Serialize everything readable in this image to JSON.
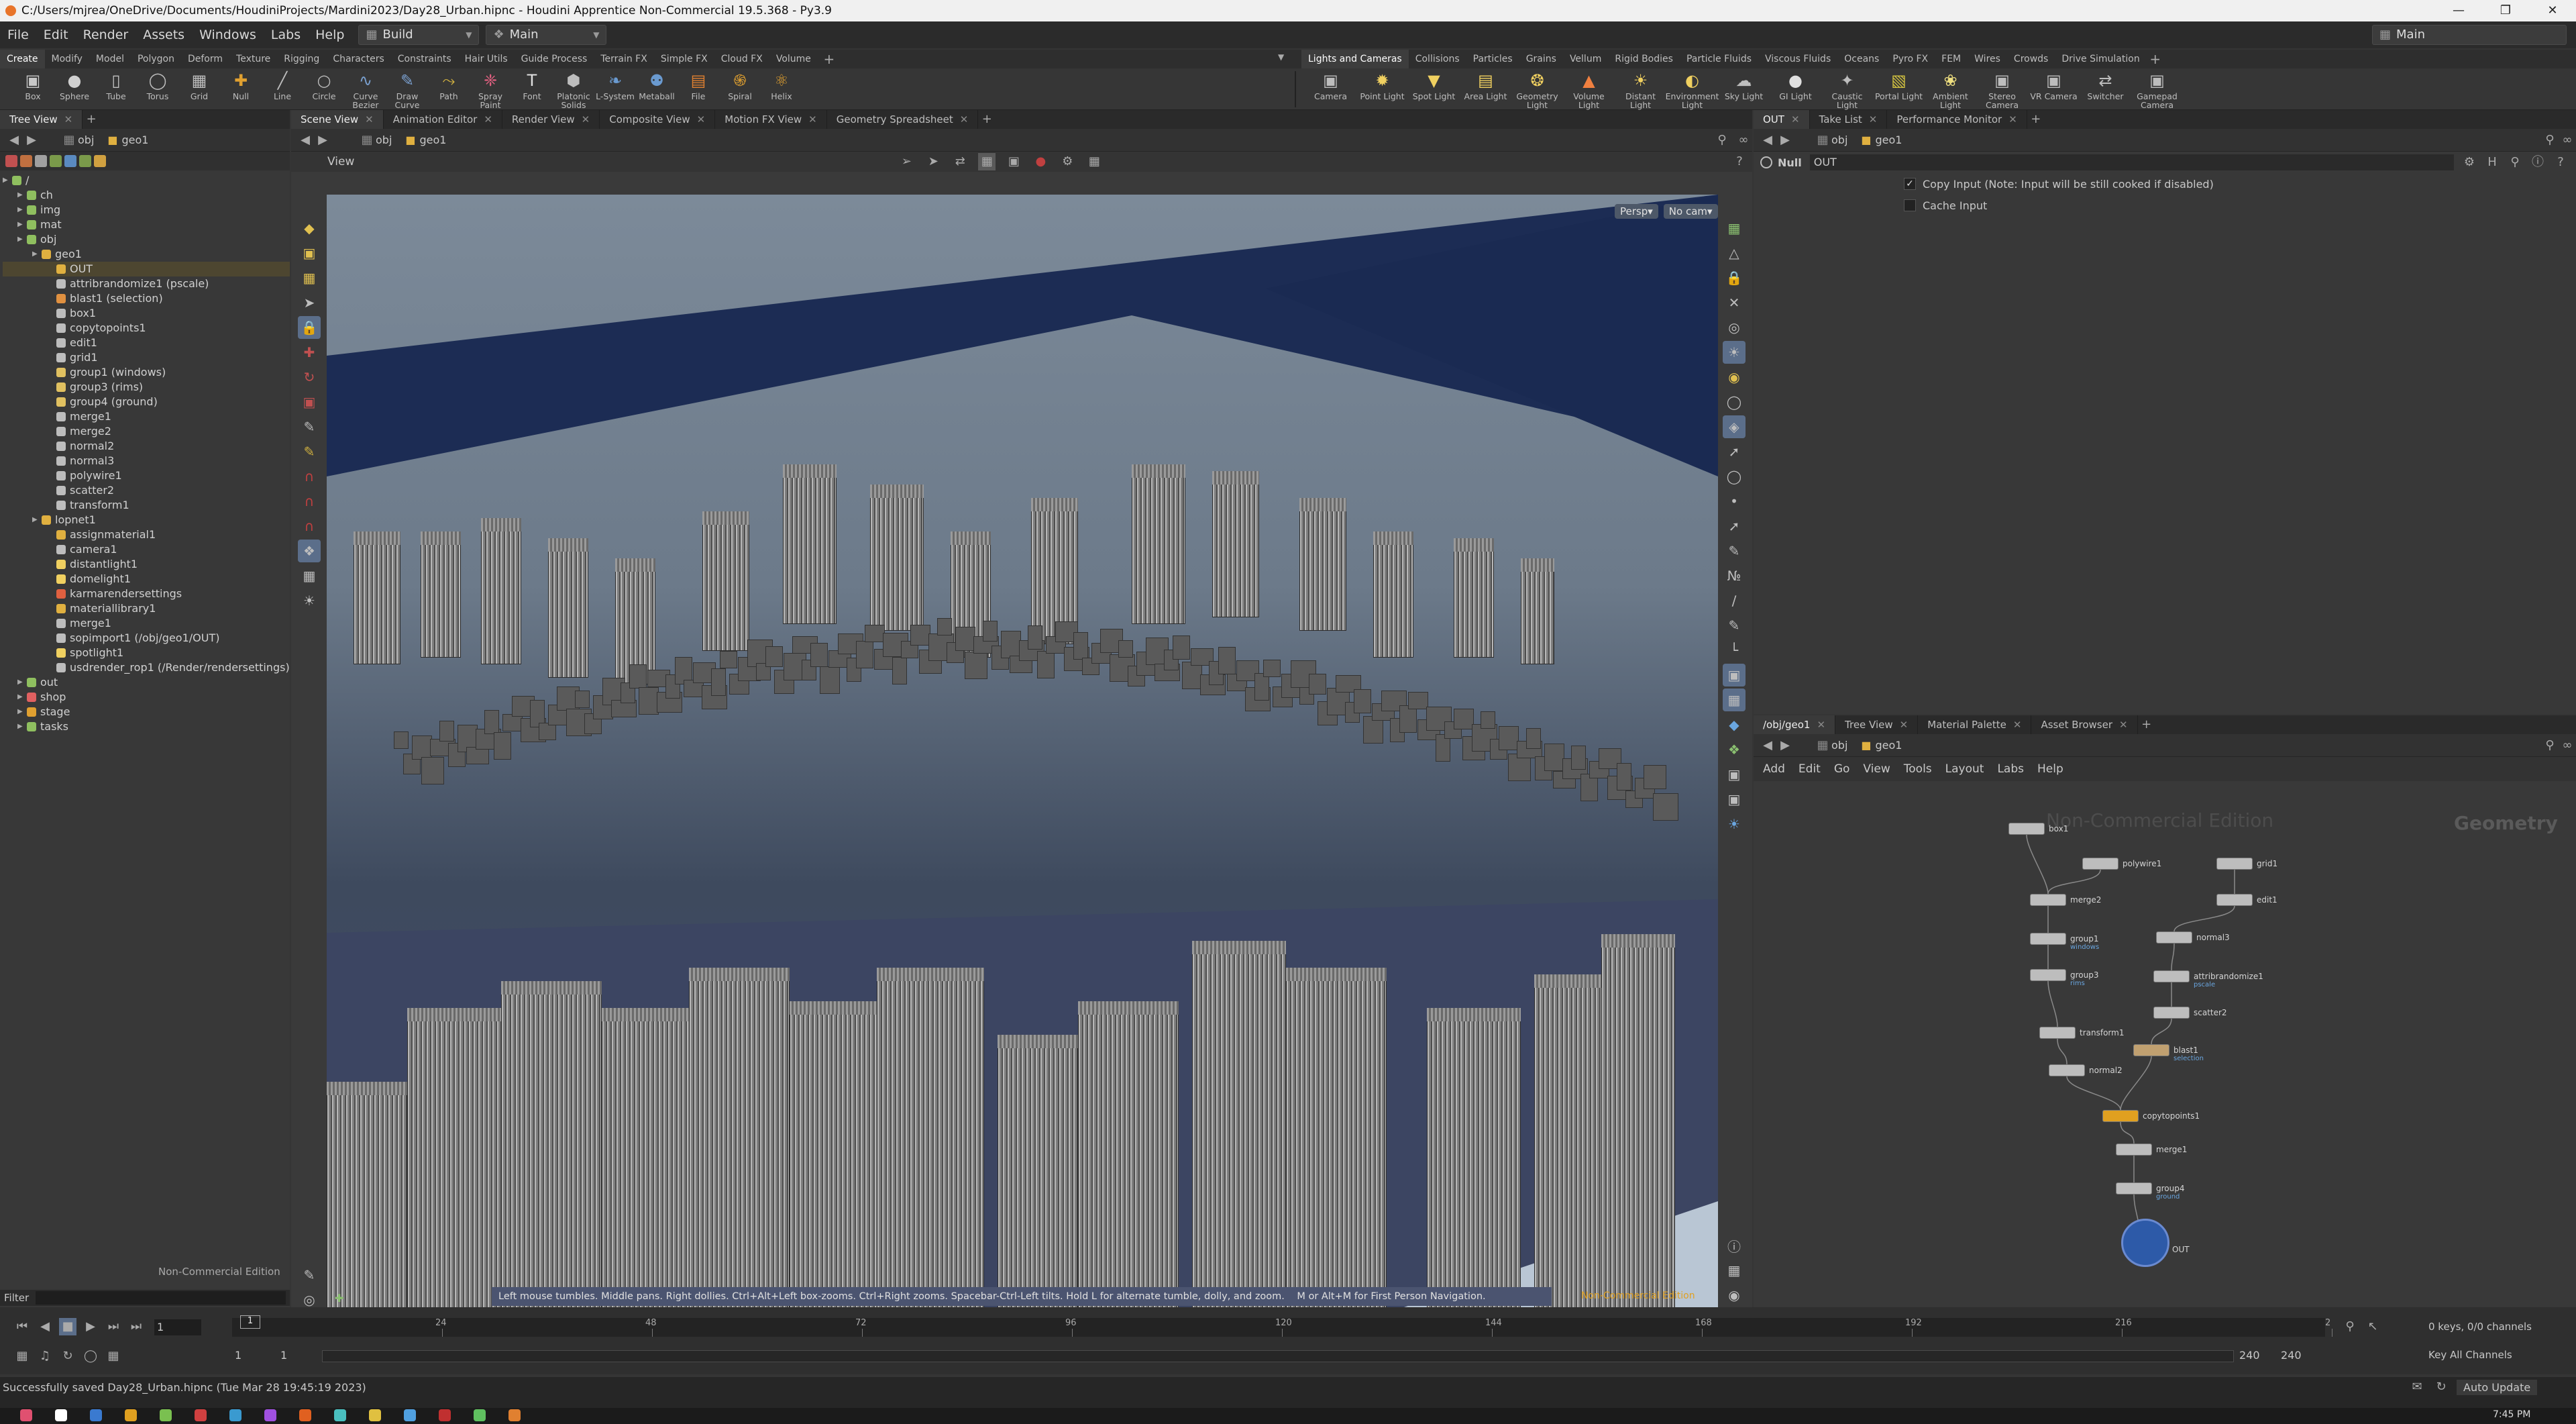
{
  "title_bar": {
    "title": "C:/Users/mjrea/OneDrive/Documents/HoudiniProjects/Mardini2023/Day28_Urban.hipnc - Houdini Apprentice Non-Commercial 19.5.368 - Py3.9"
  },
  "menu": {
    "items": [
      "File",
      "Edit",
      "Render",
      "Assets",
      "Windows",
      "Labs",
      "Help"
    ],
    "desktop_value": "Build",
    "main_value": "Main",
    "right_desktop_value": "Main"
  },
  "shelf_tabs_left": [
    "Create",
    "Modify",
    "Model",
    "Polygon",
    "Deform",
    "Texture",
    "Rigging",
    "Characters",
    "Constraints",
    "Hair Utils",
    "Guide Process",
    "Terrain FX",
    "Simple FX",
    "Cloud FX",
    "Volume"
  ],
  "shelf_tabs_right": [
    "Lights and Cameras",
    "Collisions",
    "Particles",
    "Grains",
    "Vellum",
    "Rigid Bodies",
    "Particle Fluids",
    "Viscous Fluids",
    "Oceans",
    "Pyro FX",
    "FEM",
    "Wires",
    "Crowds",
    "Drive Simulation"
  ],
  "shelf_tools_left": [
    {
      "label": "Box",
      "icon": "cube-icon",
      "color": "#c8c8c8"
    },
    {
      "label": "Sphere",
      "icon": "sphere-icon",
      "color": "#d0d0d0"
    },
    {
      "label": "Tube",
      "icon": "tube-icon",
      "color": "#c0c0c0"
    },
    {
      "label": "Torus",
      "icon": "torus-icon",
      "color": "#bdbdbd"
    },
    {
      "label": "Grid",
      "icon": "grid-icon",
      "color": "#bdbdbd"
    },
    {
      "label": "Null",
      "icon": "null-icon",
      "color": "#e0a030"
    },
    {
      "label": "Line",
      "icon": "line-icon",
      "color": "#bdbdbd"
    },
    {
      "label": "Circle",
      "icon": "circle-icon",
      "color": "#bdbdbd"
    },
    {
      "label": "Curve Bezier",
      "icon": "curve-icon",
      "color": "#7aa0d0"
    },
    {
      "label": "Draw Curve",
      "icon": "pen-icon",
      "color": "#7aa0d0"
    },
    {
      "label": "Path",
      "icon": "path-icon",
      "color": "#d0b040"
    },
    {
      "label": "Spray Paint",
      "icon": "spray-icon",
      "color": "#e06080"
    },
    {
      "label": "Font",
      "icon": "font-icon",
      "color": "#e0e0e0"
    },
    {
      "label": "Platonic Solids",
      "icon": "platonic-icon",
      "color": "#bdbdbd"
    },
    {
      "label": "L-System",
      "icon": "lsystem-icon",
      "color": "#6a9ad0"
    },
    {
      "label": "Metaball",
      "icon": "metaball-icon",
      "color": "#6a9ad0"
    },
    {
      "label": "File",
      "icon": "file-icon",
      "color": "#e08030"
    },
    {
      "label": "Spiral",
      "icon": "spiral-icon",
      "color": "#e0a030"
    },
    {
      "label": "Helix",
      "icon": "helix-icon",
      "color": "#e0a030"
    }
  ],
  "shelf_tools_right": [
    {
      "label": "Camera",
      "icon": "camera-icon",
      "color": "#bdbdbd"
    },
    {
      "label": "Point Light",
      "icon": "point-light-icon",
      "color": "#f0d060"
    },
    {
      "label": "Spot Light",
      "icon": "spot-light-icon",
      "color": "#f0d060"
    },
    {
      "label": "Area Light",
      "icon": "area-light-icon",
      "color": "#f0d060"
    },
    {
      "label": "Geometry Light",
      "icon": "geometry-light-icon",
      "color": "#f0d060"
    },
    {
      "label": "Volume Light",
      "icon": "volume-light-icon",
      "color": "#f08040"
    },
    {
      "label": "Distant Light",
      "icon": "distant-light-icon",
      "color": "#f0d060"
    },
    {
      "label": "Environment Light",
      "icon": "environment-light-icon",
      "color": "#f0d060"
    },
    {
      "label": "Sky Light",
      "icon": "sky-light-icon",
      "color": "#bdbdbd"
    },
    {
      "label": "GI Light",
      "icon": "gi-light-icon",
      "color": "#e0e0e0"
    },
    {
      "label": "Caustic Light",
      "icon": "caustic-light-icon",
      "color": "#bdbdbd"
    },
    {
      "label": "Portal Light",
      "icon": "portal-light-icon",
      "color": "#d0c040"
    },
    {
      "label": "Ambient Light",
      "icon": "ambient-light-icon",
      "color": "#f0e080"
    },
    {
      "label": "Stereo Camera",
      "icon": "stereo-camera-icon",
      "color": "#bdbdbd"
    },
    {
      "label": "VR Camera",
      "icon": "vr-camera-icon",
      "color": "#bdbdbd"
    },
    {
      "label": "Switcher",
      "icon": "switcher-icon",
      "color": "#bdbdbd"
    },
    {
      "label": "Gamepad Camera",
      "icon": "gamepad-camera-icon",
      "color": "#bdbdbd"
    }
  ],
  "tree_pane": {
    "tab": "Tree View",
    "path_obj": "obj",
    "path_node": "geo1",
    "nodes": [
      {
        "label": "/",
        "indent": 0,
        "color": "#8fbf5f"
      },
      {
        "label": "ch",
        "indent": 1,
        "color": "#8fbf5f"
      },
      {
        "label": "img",
        "indent": 1,
        "color": "#8fbf5f"
      },
      {
        "label": "mat",
        "indent": 1,
        "color": "#8fbf5f"
      },
      {
        "label": "obj",
        "indent": 1,
        "color": "#8fbf5f"
      },
      {
        "label": "geo1",
        "indent": 2,
        "color": "#e0b040"
      },
      {
        "label": "OUT",
        "indent": 3,
        "color": "#e0b040",
        "selected": true
      },
      {
        "label": "attribrandomize1 (pscale)",
        "indent": 3,
        "color": "#bdbdbd"
      },
      {
        "label": "blast1 (selection)",
        "indent": 3,
        "color": "#e09040"
      },
      {
        "label": "box1",
        "indent": 3,
        "color": "#bdbdbd"
      },
      {
        "label": "copytopoints1",
        "indent": 3,
        "color": "#bdbdbd"
      },
      {
        "label": "edit1",
        "indent": 3,
        "color": "#bdbdbd"
      },
      {
        "label": "grid1",
        "indent": 3,
        "color": "#bdbdbd"
      },
      {
        "label": "group1 (windows)",
        "indent": 3,
        "color": "#e0c060"
      },
      {
        "label": "group3 (rims)",
        "indent": 3,
        "color": "#e0c060"
      },
      {
        "label": "group4 (ground)",
        "indent": 3,
        "color": "#e0c060"
      },
      {
        "label": "merge1",
        "indent": 3,
        "color": "#bdbdbd"
      },
      {
        "label": "merge2",
        "indent": 3,
        "color": "#bdbdbd"
      },
      {
        "label": "normal2",
        "indent": 3,
        "color": "#bdbdbd"
      },
      {
        "label": "normal3",
        "indent": 3,
        "color": "#bdbdbd"
      },
      {
        "label": "polywire1",
        "indent": 3,
        "color": "#bdbdbd"
      },
      {
        "label": "scatter2",
        "indent": 3,
        "color": "#bdbdbd"
      },
      {
        "label": "transform1",
        "indent": 3,
        "color": "#bdbdbd"
      },
      {
        "label": "lopnet1",
        "indent": 2,
        "color": "#e0b040"
      },
      {
        "label": "assignmaterial1",
        "indent": 3,
        "color": "#e0b040"
      },
      {
        "label": "camera1",
        "indent": 3,
        "color": "#bdbdbd"
      },
      {
        "label": "distantlight1",
        "indent": 3,
        "color": "#f0d060"
      },
      {
        "label": "domelight1",
        "indent": 3,
        "color": "#f0d060"
      },
      {
        "label": "karmarendersettings",
        "indent": 3,
        "color": "#e06040"
      },
      {
        "label": "materiallibrary1",
        "indent": 3,
        "color": "#e0b040"
      },
      {
        "label": "merge1",
        "indent": 3,
        "color": "#bdbdbd"
      },
      {
        "label": "sopimport1 (/obj/geo1/OUT)",
        "indent": 3,
        "color": "#bdbdbd"
      },
      {
        "label": "spotlight1",
        "indent": 3,
        "color": "#f0d060"
      },
      {
        "label": "usdrender_rop1 (/Render/rendersettings)",
        "indent": 3,
        "color": "#bdbdbd"
      },
      {
        "label": "out",
        "indent": 1,
        "color": "#8fbf5f"
      },
      {
        "label": "shop",
        "indent": 1,
        "color": "#e06060"
      },
      {
        "label": "stage",
        "indent": 1,
        "color": "#e0a030"
      },
      {
        "label": "tasks",
        "indent": 1,
        "color": "#8fbf5f"
      }
    ],
    "watermark": "Non-Commercial Edition",
    "filter_label": "Filter"
  },
  "viewer": {
    "tabs": [
      "Scene View",
      "Animation Editor",
      "Render View",
      "Composite View",
      "Motion FX View",
      "Geometry Spreadsheet"
    ],
    "path_obj": "obj",
    "path_node": "geo1",
    "view_label": "View",
    "persp_label": "Persp▾",
    "cam_label": "No cam▾",
    "hint": "Left mouse tumbles. Middle pans. Right dollies. Ctrl+Alt+Left box-zooms. Ctrl+Right zooms. Spacebar-Ctrl-Left tilts. Hold L for alternate tumble, dolly, and zoom.    M or Alt+M for First Person Navigation.",
    "watermark": "Non-Commercial Edition"
  },
  "params": {
    "tabs": [
      "OUT",
      "Take List",
      "Performance Monitor"
    ],
    "path_obj": "obj",
    "path_node": "geo1",
    "node_type": "Null",
    "node_name": "OUT",
    "opt1": "Copy Input (Note: Input will be still cooked if disabled)",
    "opt2": "Cache Input"
  },
  "network": {
    "tabs": [
      "/obj/geo1",
      "Tree View",
      "Material Palette",
      "Asset Browser"
    ],
    "path_obj": "obj",
    "path_node": "geo1",
    "menu": [
      "Add",
      "Edit",
      "Go",
      "View",
      "Tools",
      "Layout",
      "Labs",
      "Help"
    ],
    "watermark": "Non-Commercial Edition",
    "context_label": "Geometry",
    "nodes": [
      {
        "name": "box1",
        "flag": ""
      },
      {
        "name": "polywire1",
        "flag": ""
      },
      {
        "name": "grid1",
        "flag": ""
      },
      {
        "name": "merge2",
        "flag": ""
      },
      {
        "name": "edit1",
        "flag": ""
      },
      {
        "name": "group1",
        "flag": "windows"
      },
      {
        "name": "normal3",
        "flag": ""
      },
      {
        "name": "group3",
        "flag": "rims"
      },
      {
        "name": "attribrandomize1",
        "flag": "pscale"
      },
      {
        "name": "scatter2",
        "flag": ""
      },
      {
        "name": "transform1",
        "flag": ""
      },
      {
        "name": "blast1",
        "flag": "selection"
      },
      {
        "name": "normal2",
        "flag": ""
      },
      {
        "name": "copytopoints1",
        "flag": ""
      },
      {
        "name": "merge1",
        "flag": ""
      },
      {
        "name": "group4",
        "flag": "ground"
      },
      {
        "name": "OUT",
        "flag": ""
      }
    ]
  },
  "timeline": {
    "frame_current": "1",
    "ticks": [
      "24",
      "48",
      "72",
      "96",
      "120",
      "144",
      "168",
      "192",
      "216",
      "2"
    ],
    "range_start": "1",
    "range_start2": "1",
    "range_end": "240",
    "range_end2": "240",
    "keys_label": "0 keys, 0/0 channels",
    "channels_label": "Key All Channels",
    "marker": "1"
  },
  "status": {
    "message": "Successfully saved Day28_Urban.hipnc (Tue Mar 28 19:45:19 2023)",
    "update_mode": "Auto Update",
    "clock": "7:45 PM"
  }
}
